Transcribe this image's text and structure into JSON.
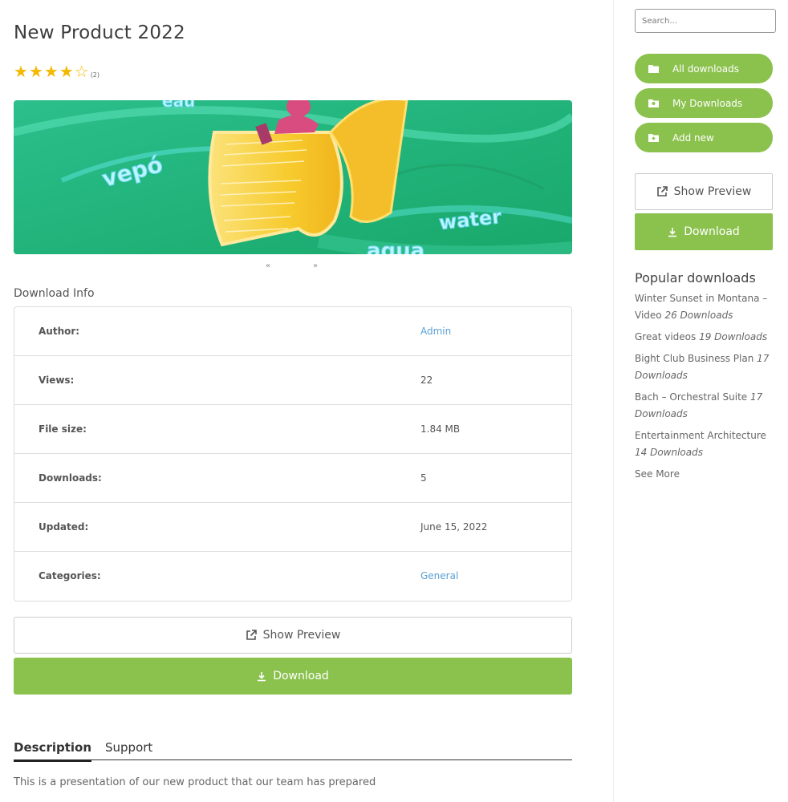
{
  "product": {
    "title": "New Product 2022",
    "rating_stars": 4,
    "rating_max": 5,
    "rating_count": "(2)"
  },
  "carousel": {
    "prev": "«",
    "next": "»"
  },
  "hero_image": {
    "words": [
      "vepó",
      "water",
      "aqua",
      "éau"
    ],
    "colors": {
      "bg": "#2fbb83",
      "scroll": "#f7cb2e"
    }
  },
  "download_info": {
    "title": "Download Info",
    "rows": [
      {
        "label": "Author:",
        "value": "Admin",
        "link": true
      },
      {
        "label": "Views:",
        "value": "22",
        "link": false
      },
      {
        "label": "File size:",
        "value": "1.84 MB",
        "link": false
      },
      {
        "label": "Downloads:",
        "value": "5",
        "link": false
      },
      {
        "label": "Updated:",
        "value": "June 15, 2022",
        "link": false
      },
      {
        "label": "Categories:",
        "value": "General",
        "link": true
      }
    ]
  },
  "buttons": {
    "preview_label": "Show Preview",
    "preview_icon": "external-link-icon",
    "download_label": "Download",
    "download_icon": "download-icon"
  },
  "tabs": [
    {
      "label": "Description",
      "active": true
    },
    {
      "label": "Support",
      "active": false
    }
  ],
  "description": "This is a presentation of our new product that our team has prepared",
  "sidebar": {
    "search_placeholder": "Search...",
    "nav": [
      {
        "label": "All downloads",
        "icon": "folder-icon"
      },
      {
        "label": "My Downloads",
        "icon": "user-folder-icon"
      },
      {
        "label": "Add new",
        "icon": "folder-plus-icon"
      }
    ],
    "preview_label": "Show Preview",
    "download_label": "Download",
    "popular_title": "Popular downloads",
    "popular": [
      {
        "name": "Winter Sunset in Montana – Video",
        "count": "26 Downloads"
      },
      {
        "name": "Great videos",
        "count": "19 Downloads"
      },
      {
        "name": "Bight Club Business Plan",
        "count": "17 Downloads"
      },
      {
        "name": "Bach – Orchestral Suite",
        "count": "17 Downloads"
      },
      {
        "name": "Entertainment Architecture",
        "count": "14 Downloads"
      }
    ],
    "see_more": "See More"
  },
  "colors": {
    "accent": "#8bc14d",
    "link": "#5a9fd4",
    "star": "#f5b800"
  }
}
